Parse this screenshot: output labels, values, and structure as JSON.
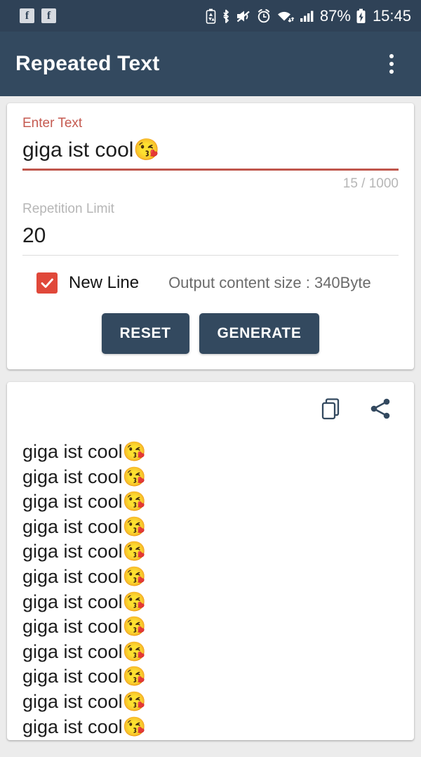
{
  "status_bar": {
    "notification_icons": [
      "facebook-icon",
      "facebook-icon"
    ],
    "system_icons": [
      "battery-saver-icon",
      "bluetooth-icon",
      "mute-icon",
      "alarm-icon",
      "wifi-icon",
      "signal-icon"
    ],
    "battery_percent": "87%",
    "charging_icon": "battery-charging-icon",
    "time": "15:45"
  },
  "app_bar": {
    "title": "Repeated Text",
    "overflow_menu": "more-options-icon"
  },
  "input_card": {
    "text_label": "Enter Text",
    "text_value": "giga ist cool😘",
    "counter": "15 / 1000",
    "limit_label": "Repetition Limit",
    "limit_value": "20",
    "newline_label": "New Line",
    "newline_checked": true,
    "output_size": "Output content size : 340Byte",
    "reset_label": "RESET",
    "generate_label": "GENERATE"
  },
  "output_card": {
    "copy_icon": "copy-icon",
    "share_icon": "share-icon",
    "line_text": "giga ist cool😘",
    "visible_lines": 12,
    "lines": [
      "giga ist cool😘",
      "giga ist cool😘",
      "giga ist cool😘",
      "giga ist cool😘",
      "giga ist cool😘",
      "giga ist cool😘",
      "giga ist cool😘",
      "giga ist cool😘",
      "giga ist cool😘",
      "giga ist cool😘",
      "giga ist cool😘",
      "giga ist cool😘"
    ]
  },
  "colors": {
    "app_bar": "#33495f",
    "status_bar": "#2f4257",
    "accent_red": "#c0564c",
    "checkbox_red": "#e0483a",
    "page_bg": "#ececec"
  }
}
